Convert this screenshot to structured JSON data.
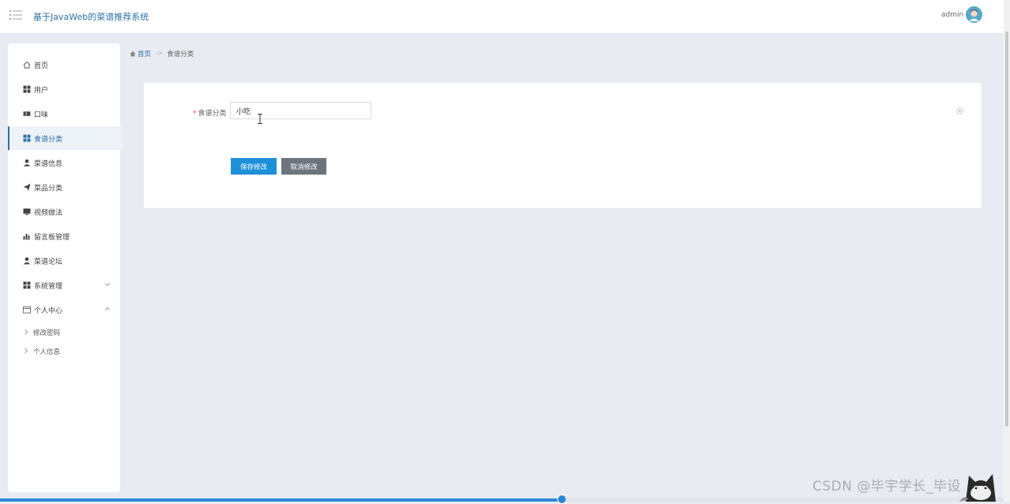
{
  "header": {
    "title": "基于JavaWeb的菜谱推荐系统",
    "username": "admin"
  },
  "sidebar": {
    "items": [
      {
        "label": "首页",
        "icon": "home-icon"
      },
      {
        "label": "用户",
        "icon": "grid-icon"
      },
      {
        "label": "口味",
        "icon": "ticket-icon"
      },
      {
        "label": "食谱分类",
        "icon": "grid-icon",
        "active": true
      },
      {
        "label": "菜谱信息",
        "icon": "user-icon"
      },
      {
        "label": "菜品分类",
        "icon": "send-icon"
      },
      {
        "label": "视频做法",
        "icon": "monitor-icon"
      },
      {
        "label": "留言板管理",
        "icon": "bar-chart-icon"
      },
      {
        "label": "菜谱论坛",
        "icon": "user-icon"
      },
      {
        "label": "系统管理",
        "icon": "grid-icon",
        "expandable": "collapsed"
      },
      {
        "label": "个人中心",
        "icon": "calendar-icon",
        "expandable": "expanded"
      }
    ],
    "subitems": [
      {
        "label": "修改密码"
      },
      {
        "label": "个人信息"
      }
    ]
  },
  "breadcrumb": {
    "home": "首页",
    "separator": "->",
    "current": "食谱分类"
  },
  "form": {
    "required_mark": "*",
    "field_label": "食谱分类",
    "field_value": "小吃",
    "save_label": "保存修改",
    "cancel_label": "取消修改"
  },
  "page_progress": 0.56,
  "watermark": "CSDN @毕宇学长_毕设",
  "colors": {
    "accent": "#2d6fa8",
    "save_button": "#1e90d8",
    "cancel_button": "#6c757d",
    "background": "#e9ebf3"
  }
}
